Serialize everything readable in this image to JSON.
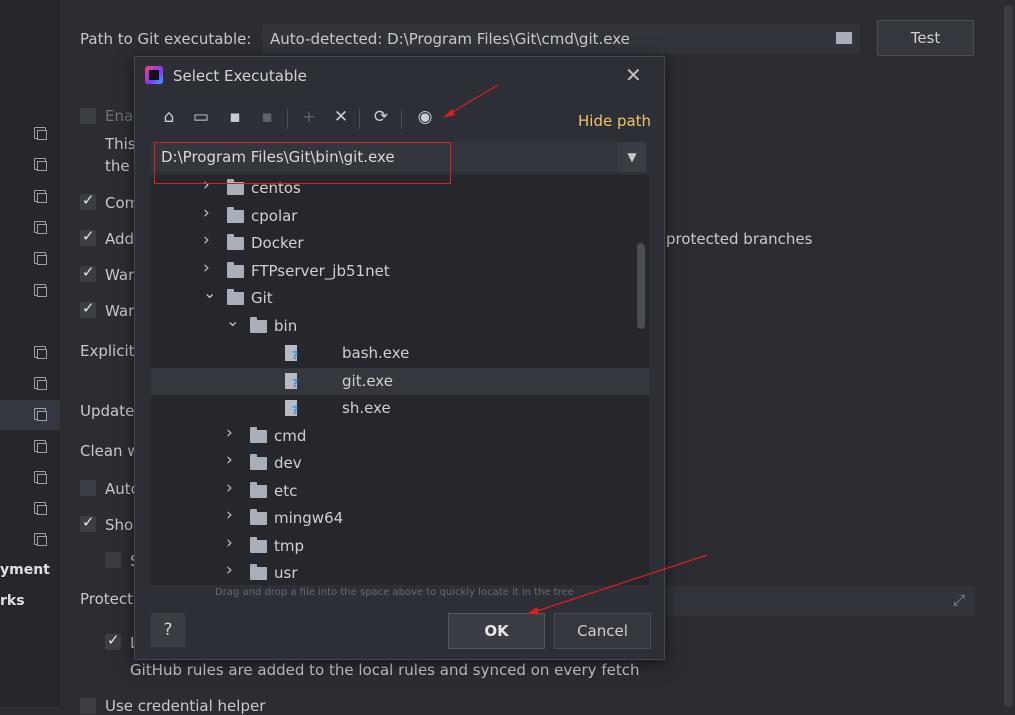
{
  "settings": {
    "path_label": "Path to Git executable:",
    "path_value": "Auto-detected: D:\\Program Files\\Git\\cmd\\git.exe",
    "test_label": "Test",
    "frag_enable": "Enab",
    "frag_this": "This",
    "frag_the": "the p",
    "frag_com": "Com",
    "frag_add": "Add",
    "frag_protected": "protected branches",
    "frag_war1": "War",
    "frag_war2": "War",
    "frag_explicit": "Explicit",
    "frag_update": "Update",
    "frag_clean": "Clean w",
    "frag_auto": "Auto",
    "frag_show": "Show",
    "frag_s": "S",
    "frag_protect": "Protect",
    "frag_l": "L",
    "github_rules": "GitHub rules are added to the local rules and synced on every fetch",
    "frag_credential": "Use credential helper"
  },
  "sidebar": {
    "text_deployment": "yment",
    "text_works": "rks"
  },
  "dialog": {
    "title": "Select Executable",
    "close": "✕",
    "toolbar": {
      "home": "⌂",
      "desktop": "▭",
      "project": "▪",
      "module": "▪",
      "new_folder": "+",
      "delete": "✕",
      "refresh": "⟳",
      "show_hidden": "◉"
    },
    "hide_path": "Hide path",
    "path_value": "D:\\Program Files\\Git\\bin\\git.exe",
    "combo_arrow": "▼",
    "tree": [
      {
        "name": "centos",
        "type": "folder",
        "depth": 0,
        "expanded": false
      },
      {
        "name": "cpolar",
        "type": "folder",
        "depth": 0,
        "expanded": false
      },
      {
        "name": "Docker",
        "type": "folder",
        "depth": 0,
        "expanded": false
      },
      {
        "name": "FTPserver_jb51net",
        "type": "folder",
        "depth": 0,
        "expanded": false
      },
      {
        "name": "Git",
        "type": "folder",
        "depth": 0,
        "expanded": true
      },
      {
        "name": "bin",
        "type": "folder",
        "depth": 1,
        "expanded": true
      },
      {
        "name": "bash.exe",
        "type": "file",
        "depth": 2
      },
      {
        "name": "git.exe",
        "type": "file",
        "depth": 2,
        "selected": true
      },
      {
        "name": "sh.exe",
        "type": "file",
        "depth": 2
      },
      {
        "name": "cmd",
        "type": "folder",
        "depth": 1,
        "expanded": false
      },
      {
        "name": "dev",
        "type": "folder",
        "depth": 1,
        "expanded": false
      },
      {
        "name": "etc",
        "type": "folder",
        "depth": 1,
        "expanded": false
      },
      {
        "name": "mingw64",
        "type": "folder",
        "depth": 1,
        "expanded": false
      },
      {
        "name": "tmp",
        "type": "folder",
        "depth": 1,
        "expanded": false
      },
      {
        "name": "usr",
        "type": "folder",
        "depth": 1,
        "expanded": false
      }
    ],
    "drop_hint": "Drag and drop a file into the space above to quickly locate it in the tree",
    "help": "?",
    "ok": "OK",
    "cancel": "Cancel"
  },
  "colors": {
    "accent_link": "#f0c36a",
    "annotation": "#e01e1e"
  }
}
